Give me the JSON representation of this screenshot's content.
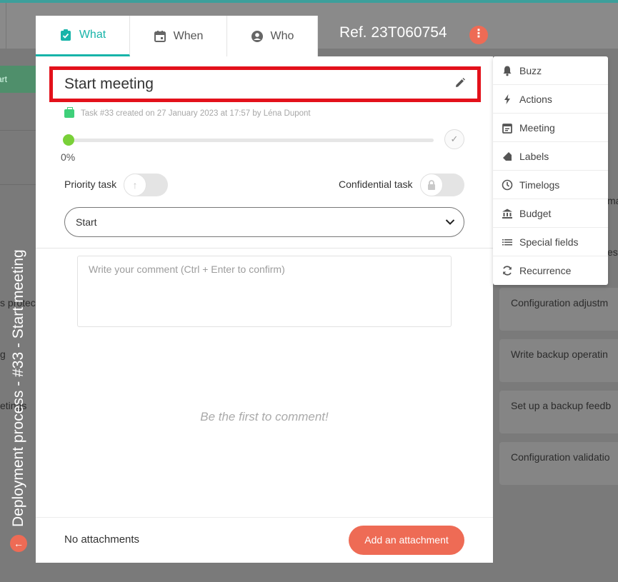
{
  "background": {
    "left_green_label": "art",
    "left_rows": [
      "s protect",
      "g",
      "etings"
    ],
    "right_peeks": [
      "ma",
      "est"
    ],
    "right_cards": [
      "Configuration adjustm",
      "Write backup operatin",
      "Set up a backup feedb",
      "Configuration validatio"
    ]
  },
  "side_title": "Deployment process - #33 - Start meeting",
  "tabs": [
    {
      "label": "What",
      "icon": "clipboard-check-icon",
      "active": true
    },
    {
      "label": "When",
      "icon": "calendar-icon",
      "active": false
    },
    {
      "label": "Who",
      "icon": "user-circle-icon",
      "active": false
    }
  ],
  "reference": "Ref. 23T060754",
  "task": {
    "title": "Start meeting",
    "meta": "Task #33 created on 27 January 2023 at 17:57 by Léna Dupont",
    "progress_percent": 0,
    "progress_label": "0%",
    "priority_label": "Priority task",
    "priority_on": false,
    "confidential_label": "Confidential task",
    "confidential_on": false,
    "status_value": "Start"
  },
  "comments": {
    "placeholder": "Write your comment (Ctrl + Enter to confirm)",
    "empty_text": "Be the first to comment!"
  },
  "attachments": {
    "empty_text": "No attachments",
    "add_button": "Add an attachment"
  },
  "menu": [
    {
      "label": "Buzz",
      "icon": "bell-icon"
    },
    {
      "label": "Actions",
      "icon": "lightning-icon"
    },
    {
      "label": "Meeting",
      "icon": "calendar-icon"
    },
    {
      "label": "Labels",
      "icon": "tag-icon"
    },
    {
      "label": "Timelogs",
      "icon": "clock-icon"
    },
    {
      "label": "Budget",
      "icon": "bank-icon"
    },
    {
      "label": "Special fields",
      "icon": "list-icon"
    },
    {
      "label": "Recurrence",
      "icon": "refresh-icon"
    }
  ],
  "colors": {
    "accent": "#17b4a9",
    "danger": "#ee6b55",
    "highlight_border": "#e3111b",
    "progress": "#79d038"
  }
}
